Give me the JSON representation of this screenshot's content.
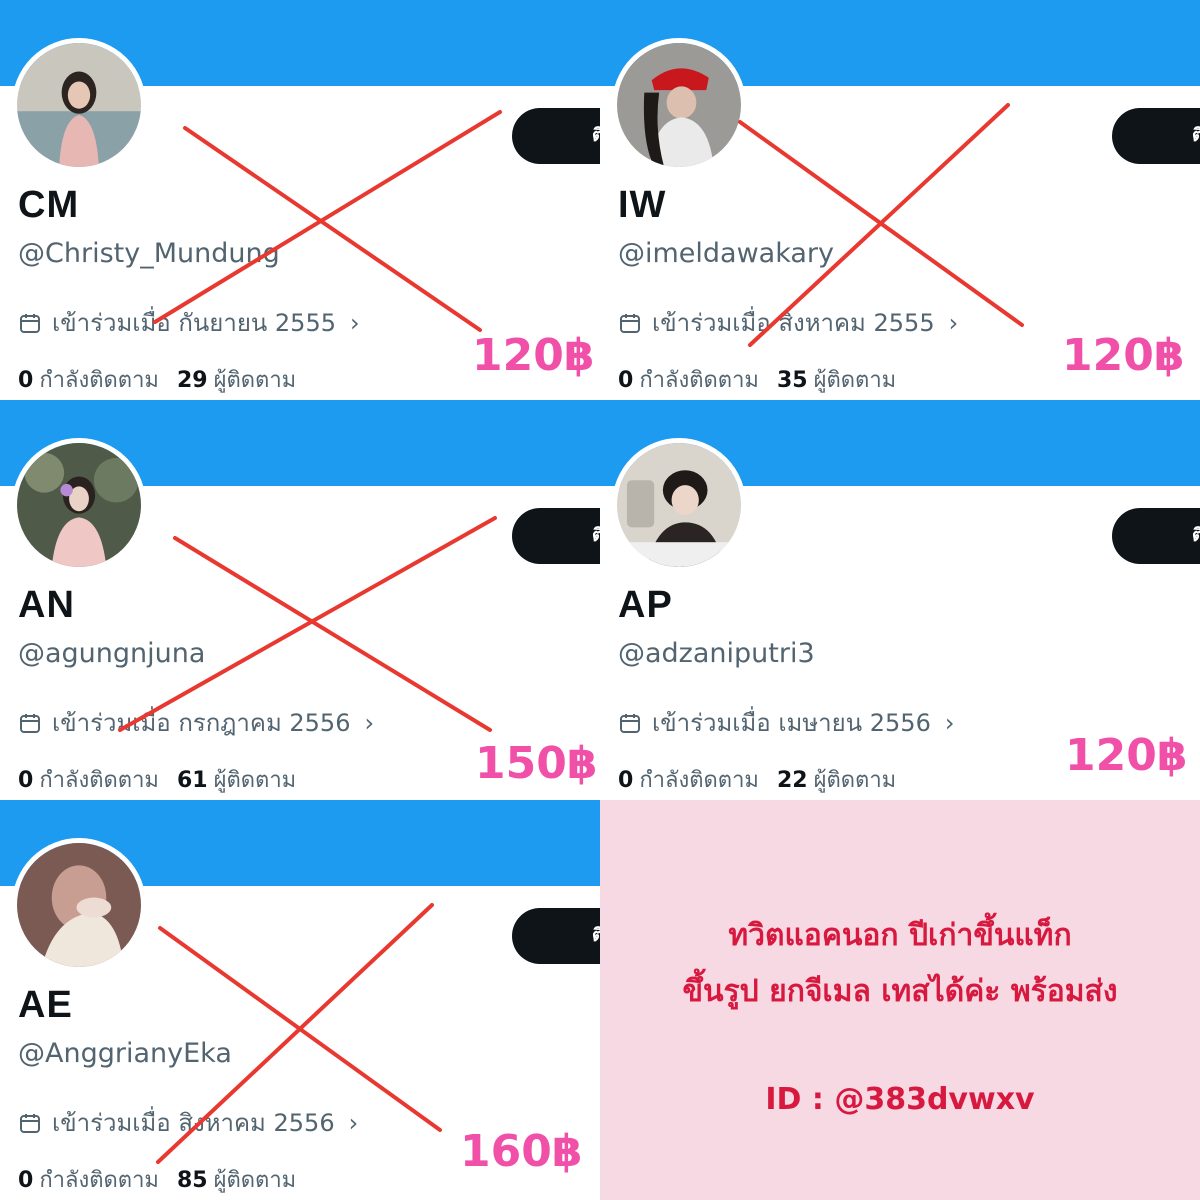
{
  "cards": [
    {
      "name": "CM",
      "handle": "@Christy_Mundung",
      "joined": "เข้าร่วมเมื่อ กันยายน 2555",
      "following": "0",
      "following_label": "กำลังติดตาม",
      "followers": "29",
      "followers_label": "ผู้ติดตาม",
      "price": "120฿",
      "button_label": "ติ",
      "crossed": true
    },
    {
      "name": "IW",
      "handle": "@imeldawakary",
      "joined": "เข้าร่วมเมื่อ สิงหาคม 2555",
      "following": "0",
      "following_label": "กำลังติดตาม",
      "followers": "35",
      "followers_label": "ผู้ติดตาม",
      "price": "120฿",
      "button_label": "ติ",
      "crossed": true
    },
    {
      "name": "AN",
      "handle": "@agungnjuna",
      "joined": "เข้าร่วมเมื่อ กรกฎาคม 2556",
      "following": "0",
      "following_label": "กำลังติดตาม",
      "followers": "61",
      "followers_label": "ผู้ติดตาม",
      "price": "150฿",
      "button_label": "ติ",
      "crossed": true
    },
    {
      "name": "AP",
      "handle": "@adzaniputri3",
      "joined": "เข้าร่วมเมื่อ เมษายน 2556",
      "following": "0",
      "following_label": "กำลังติดตาม",
      "followers": "22",
      "followers_label": "ผู้ติดตาม",
      "price": "120฿",
      "button_label": "ติ",
      "crossed": false
    },
    {
      "name": "AE",
      "handle": "@AnggrianyEka",
      "joined": "เข้าร่วมเมื่อ สิงหาคม 2556",
      "following": "0",
      "following_label": "กำลังติดตาม",
      "followers": "85",
      "followers_label": "ผู้ติดตาม",
      "price": "160฿",
      "button_label": "ติ",
      "crossed": true
    }
  ],
  "promo": {
    "line1": "ทวิตแอคนอก ปีเก่าขึ้นแท็ก",
    "line2": "ขึ้นรูป ยกจีเมล เทสได้ค่ะ พร้อมส่ง",
    "line3": "ID : @383dvwxv"
  },
  "colors": {
    "banner": "#1d9bf0",
    "price": "#f050a8",
    "cross": "#e8382f",
    "promo_bg": "#f7d9e3",
    "promo_text": "#d8193f"
  }
}
